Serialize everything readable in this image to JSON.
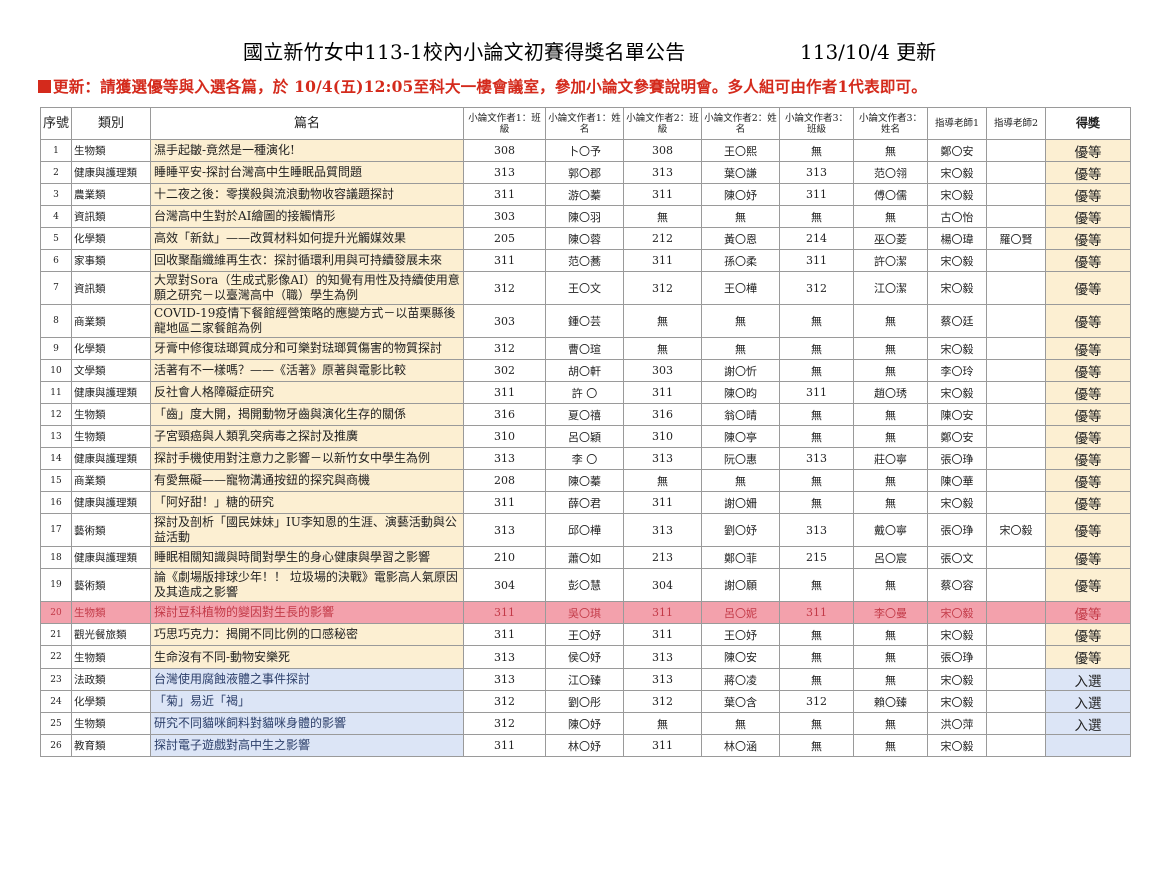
{
  "title": "國立新竹女中113-1校內小論文初賽得獎名單公告",
  "date_note": "113/10/4 更新",
  "notice": "更新：請獲選優等與入選各篇，於 10/4(五)12:05至科大一樓會議室，參加小論文參賽說明會。多人組可由作者1代表即可。",
  "headers": {
    "no": "序號",
    "category": "類別",
    "title": "篇名",
    "a1_class": "小論文作者1：班級",
    "a1_name": "小論文作者1：姓名",
    "a2_class": "小論文作者2：班級",
    "a2_name": "小論文作者2：姓名",
    "a3_class": "小論文作者3：班級",
    "a3_name": "小論文作者3：姓名",
    "t1": "指導老師1",
    "t2": "指導老師2",
    "award": "得獎"
  },
  "rows": [
    {
      "no": "1",
      "cat": "生物類",
      "title": "濕手起皺-竟然是一種演化!",
      "c1": "308",
      "n1": "卜〇予",
      "c2": "308",
      "n2": "王〇熙",
      "c3": "無",
      "n3": "無",
      "t1": "鄭〇安",
      "t2": "",
      "award": "優等"
    },
    {
      "no": "2",
      "cat": "健康與護理類",
      "title": "睡睡平安-探討台灣高中生睡眠品質問題",
      "c1": "313",
      "n1": "郭〇郡",
      "c2": "313",
      "n2": "葉〇謙",
      "c3": "313",
      "n3": "范〇翎",
      "t1": "宋〇毅",
      "t2": "",
      "award": "優等"
    },
    {
      "no": "3",
      "cat": "農業類",
      "title": "十二夜之後：零撲殺與流浪動物收容議題探討",
      "c1": "311",
      "n1": "游〇蓁",
      "c2": "311",
      "n2": "陳〇妤",
      "c3": "311",
      "n3": "傅〇儒",
      "t1": "宋〇毅",
      "t2": "",
      "award": "優等"
    },
    {
      "no": "4",
      "cat": "資訊類",
      "title": "台灣高中生對於AI繪圖的接觸情形",
      "c1": "303",
      "n1": "陳〇羽",
      "c2": "無",
      "n2": "無",
      "c3": "無",
      "n3": "無",
      "t1": "古〇怡",
      "t2": "",
      "award": "優等"
    },
    {
      "no": "5",
      "cat": "化學類",
      "title": "高效「新鈦」——改質材料如何提升光觸媒效果",
      "c1": "205",
      "n1": "陳〇蓉",
      "c2": "212",
      "n2": "黃〇恩",
      "c3": "214",
      "n3": "巫〇菱",
      "t1": "楊〇瑋",
      "t2": "羅〇賢",
      "award": "優等"
    },
    {
      "no": "6",
      "cat": "家事類",
      "title": "回收聚酯纖維再生衣：探討循環利用與可持續發展未來",
      "c1": "311",
      "n1": "范〇蕎",
      "c2": "311",
      "n2": "孫〇柔",
      "c3": "311",
      "n3": "許〇潔",
      "t1": "宋〇毅",
      "t2": "",
      "award": "優等"
    },
    {
      "no": "7",
      "cat": "資訊類",
      "title": "大眾對Sora（生成式影像AI）的知覺有用性及持續使用意願之研究－以臺灣高中（職）學生為例",
      "c1": "312",
      "n1": "王〇文",
      "c2": "312",
      "n2": "王〇樺",
      "c3": "312",
      "n3": "江〇潔",
      "t1": "宋〇毅",
      "t2": "",
      "award": "優等"
    },
    {
      "no": "8",
      "cat": "商業類",
      "title": "COVID-19疫情下餐館經營策略的應變方式－以苗栗縣後龍地區二家餐館為例",
      "c1": "303",
      "n1": "鍾〇芸",
      "c2": "無",
      "n2": "無",
      "c3": "無",
      "n3": "無",
      "t1": "蔡〇廷",
      "t2": "",
      "award": "優等"
    },
    {
      "no": "9",
      "cat": "化學類",
      "title": "牙膏中修復琺瑯質成分和可樂對琺瑯質傷害的物質探討",
      "c1": "312",
      "n1": "曹〇瑄",
      "c2": "無",
      "n2": "無",
      "c3": "無",
      "n3": "無",
      "t1": "宋〇毅",
      "t2": "",
      "award": "優等"
    },
    {
      "no": "10",
      "cat": "文學類",
      "title": "活著有不一樣嗎？——《活著》原著與電影比較",
      "c1": "302",
      "n1": "胡〇軒",
      "c2": "303",
      "n2": "謝〇忻",
      "c3": "無",
      "n3": "無",
      "t1": "李〇玲",
      "t2": "",
      "award": "優等"
    },
    {
      "no": "11",
      "cat": "健康與護理類",
      "title": "反社會人格障礙症研究",
      "c1": "311",
      "n1": "許 〇",
      "c2": "311",
      "n2": "陳〇昀",
      "c3": "311",
      "n3": "趙〇琇",
      "t1": "宋〇毅",
      "t2": "",
      "award": "優等"
    },
    {
      "no": "12",
      "cat": "生物類",
      "title": "「齒」度大開，揭開動物牙齒與演化生存的關係",
      "c1": "316",
      "n1": "夏〇禧",
      "c2": "316",
      "n2": "翁〇晴",
      "c3": "無",
      "n3": "無",
      "t1": "陳〇安",
      "t2": "",
      "award": "優等"
    },
    {
      "no": "13",
      "cat": "生物類",
      "title": "子宮頸癌與人類乳突病毒之探討及推廣",
      "c1": "310",
      "n1": "呂〇穎",
      "c2": "310",
      "n2": "陳〇亭",
      "c3": "無",
      "n3": "無",
      "t1": "鄭〇安",
      "t2": "",
      "award": "優等"
    },
    {
      "no": "14",
      "cat": "健康與護理類",
      "title": "探討手機使用對注意力之影響－以新竹女中學生為例",
      "c1": "313",
      "n1": "李 〇",
      "c2": "313",
      "n2": "阮〇惠",
      "c3": "313",
      "n3": "莊〇寧",
      "t1": "張〇琤",
      "t2": "",
      "award": "優等"
    },
    {
      "no": "15",
      "cat": "商業類",
      "title": "有愛無礙——寵物溝通按鈕的探究與商機",
      "c1": "208",
      "n1": "陳〇蓁",
      "c2": "無",
      "n2": "無",
      "c3": "無",
      "n3": "無",
      "t1": "陳〇華",
      "t2": "",
      "award": "優等"
    },
    {
      "no": "16",
      "cat": "健康與護理類",
      "title": "「阿好甜！」糖的研究",
      "c1": "311",
      "n1": "薛〇君",
      "c2": "311",
      "n2": "謝〇姍",
      "c3": "無",
      "n3": "無",
      "t1": "宋〇毅",
      "t2": "",
      "award": "優等"
    },
    {
      "no": "17",
      "cat": "藝術類",
      "title": "探討及剖析「國民妹妹」IU李知恩的生涯、演藝活動與公益活動",
      "c1": "313",
      "n1": "邱〇樺",
      "c2": "313",
      "n2": "劉〇妤",
      "c3": "313",
      "n3": "戴〇寧",
      "t1": "張〇琤",
      "t2": "宋〇毅",
      "award": "優等"
    },
    {
      "no": "18",
      "cat": "健康與護理類",
      "title": "睡眠相關知識與時間對學生的身心健康與學習之影響",
      "c1": "210",
      "n1": "蕭〇如",
      "c2": "213",
      "n2": "鄭〇菲",
      "c3": "215",
      "n3": "呂〇宸",
      "t1": "張〇文",
      "t2": "",
      "award": "優等"
    },
    {
      "no": "19",
      "cat": "藝術類",
      "title": "論《劇場版排球少年！！ 垃圾場的決戰》電影高人氣原因及其造成之影響",
      "c1": "304",
      "n1": "彭〇慧",
      "c2": "304",
      "n2": "謝〇願",
      "c3": "無",
      "n3": "無",
      "t1": "蔡〇容",
      "t2": "",
      "award": "優等"
    },
    {
      "no": "20",
      "cat": "生物類",
      "title": "探討豆科植物的變因對生長的影響",
      "c1": "311",
      "n1": "吳〇琪",
      "c2": "311",
      "n2": "呂〇妮",
      "c3": "311",
      "n3": "李〇曼",
      "t1": "宋〇毅",
      "t2": "",
      "award": "優等"
    },
    {
      "no": "21",
      "cat": "觀光餐旅類",
      "title": "巧思巧克力：揭開不同比例的口感秘密",
      "c1": "311",
      "n1": "王〇妤",
      "c2": "311",
      "n2": "王〇妤",
      "c3": "無",
      "n3": "無",
      "t1": "宋〇毅",
      "t2": "",
      "award": "優等"
    },
    {
      "no": "22",
      "cat": "生物類",
      "title": "生命沒有不同-動物安樂死",
      "c1": "313",
      "n1": "侯〇妤",
      "c2": "313",
      "n2": "陳〇安",
      "c3": "無",
      "n3": "無",
      "t1": "張〇琤",
      "t2": "",
      "award": "優等"
    },
    {
      "no": "23",
      "cat": "法政類",
      "title": "台灣使用腐蝕液體之事件探討",
      "c1": "313",
      "n1": "江〇臻",
      "c2": "313",
      "n2": "蔣〇凌",
      "c3": "無",
      "n3": "無",
      "t1": "宋〇毅",
      "t2": "",
      "award": "入選"
    },
    {
      "no": "24",
      "cat": "化學類",
      "title": "「菊」易近「褐」",
      "c1": "312",
      "n1": "劉〇彤",
      "c2": "312",
      "n2": "葉〇含",
      "c3": "312",
      "n3": "賴〇臻",
      "t1": "宋〇毅",
      "t2": "",
      "award": "入選"
    },
    {
      "no": "25",
      "cat": "生物類",
      "title": "研究不同貓咪飼料對貓咪身體的影響",
      "c1": "312",
      "n1": "陳〇妤",
      "c2": "無",
      "n2": "無",
      "c3": "無",
      "n3": "無",
      "t1": "洪〇萍",
      "t2": "",
      "award": "入選"
    },
    {
      "no": "26",
      "cat": "教育類",
      "title": "探討電子遊戲對高中生之影響",
      "c1": "311",
      "n1": "林〇妤",
      "c2": "311",
      "n2": "林〇涵",
      "c3": "無",
      "n3": "無",
      "t1": "宋〇毅",
      "t2": "",
      "award": ""
    }
  ],
  "highlighted_row": "20",
  "colors": {
    "notice_red": "#d42a1c",
    "title_bg": "#fcefd2",
    "title_text": "#b06a07",
    "selected_bg": "#dce5f6",
    "award_red": "#ea4a43",
    "highlight_pink": "#f3a1ac"
  }
}
